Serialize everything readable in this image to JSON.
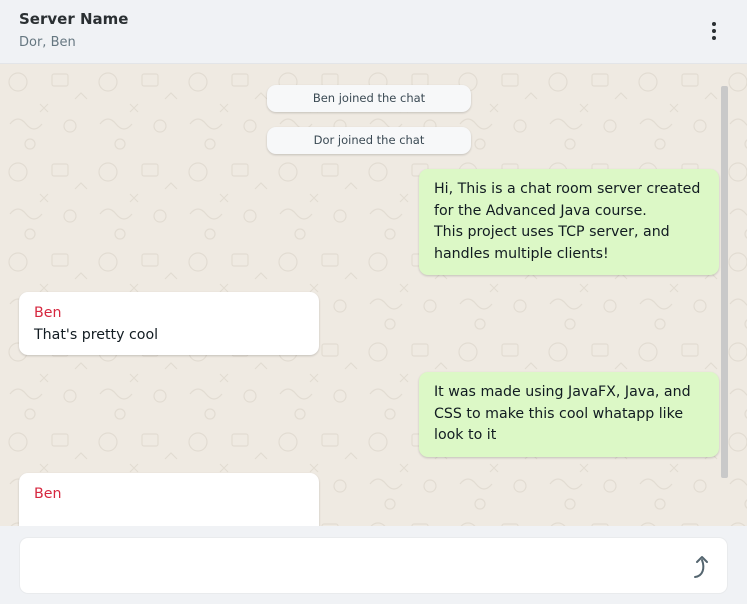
{
  "header": {
    "title": "Server Name",
    "subtitle": "Dor, Ben"
  },
  "system_messages": [
    "Ben joined the chat",
    "Dor joined the chat"
  ],
  "messages": [
    {
      "direction": "outgoing",
      "lines": [
        "Hi, This is a chat room server created",
        "for the Advanced Java course.",
        "This project uses TCP server, and",
        "handles multiple clients!"
      ]
    },
    {
      "direction": "incoming",
      "sender": "Ben",
      "lines": [
        "That's pretty cool"
      ]
    },
    {
      "direction": "outgoing",
      "lines": [
        "It was made using JavaFX, Java, and",
        "CSS to make this cool whatapp like",
        "look to it"
      ]
    },
    {
      "direction": "incoming",
      "sender": "Ben",
      "lines": []
    }
  ],
  "composer": {
    "value": "",
    "placeholder": ""
  },
  "icons": {
    "menu": "more-vertical-icon",
    "send": "send-icon"
  },
  "colors": {
    "outgoing_bubble": "#dcf8c6",
    "incoming_bubble": "#ffffff",
    "sender_name": "#d6273f",
    "chat_background": "#efeae2"
  }
}
